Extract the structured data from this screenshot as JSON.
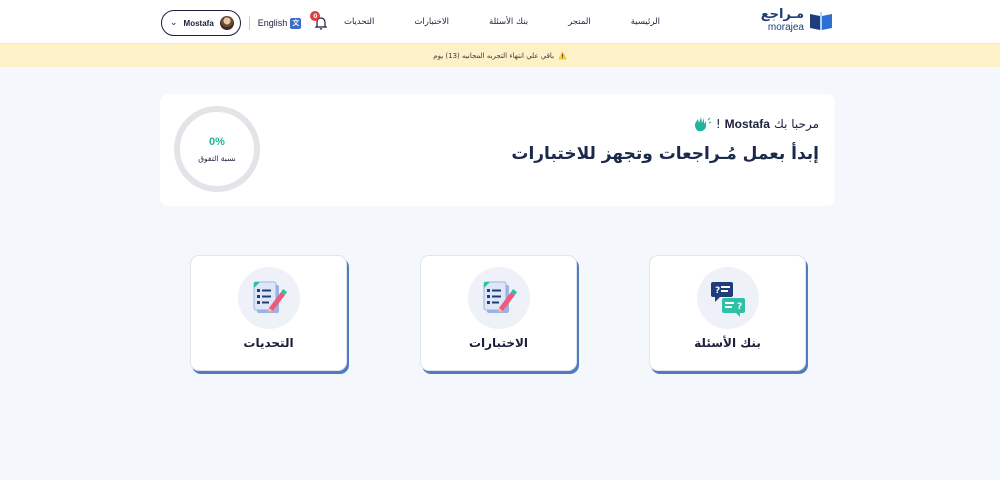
{
  "brand": {
    "name_ar": "مـراجع",
    "name_en": "morajea"
  },
  "nav": [
    {
      "label": "الرئيسية"
    },
    {
      "label": "المتجر"
    },
    {
      "label": "بنك الأسئلة"
    },
    {
      "label": "الاختبارات"
    },
    {
      "label": "التحديات"
    }
  ],
  "user": {
    "name": "Mostafa",
    "chevron": "⌄"
  },
  "lang": {
    "label": "English"
  },
  "notifications": {
    "count": "0"
  },
  "banner": {
    "icon": "⚠️",
    "text": "باقي علي انتهاء التجربه المجانيه (13) يوم"
  },
  "welcome": {
    "greeting": "مرحبا بك",
    "name": "Mostafa",
    "exclaim": "!",
    "headline": "إبدأ بعمل مُـراجعات وتجهز للاختبارات"
  },
  "progress": {
    "percent_label": "0%",
    "percent": 0,
    "label": "نسبة التفوق"
  },
  "cards": [
    {
      "label": "بنك الأسئلة",
      "icon": "question-bank-icon"
    },
    {
      "label": "الاختبارات",
      "icon": "exam-checklist-icon"
    },
    {
      "label": "التحديات",
      "icon": "challenge-checklist-icon"
    }
  ],
  "colors": {
    "accent": "#1fb59a",
    "brand": "#1f3d7a",
    "banner": "#fdf1c7",
    "card_shadow": "#4f7cbf"
  }
}
